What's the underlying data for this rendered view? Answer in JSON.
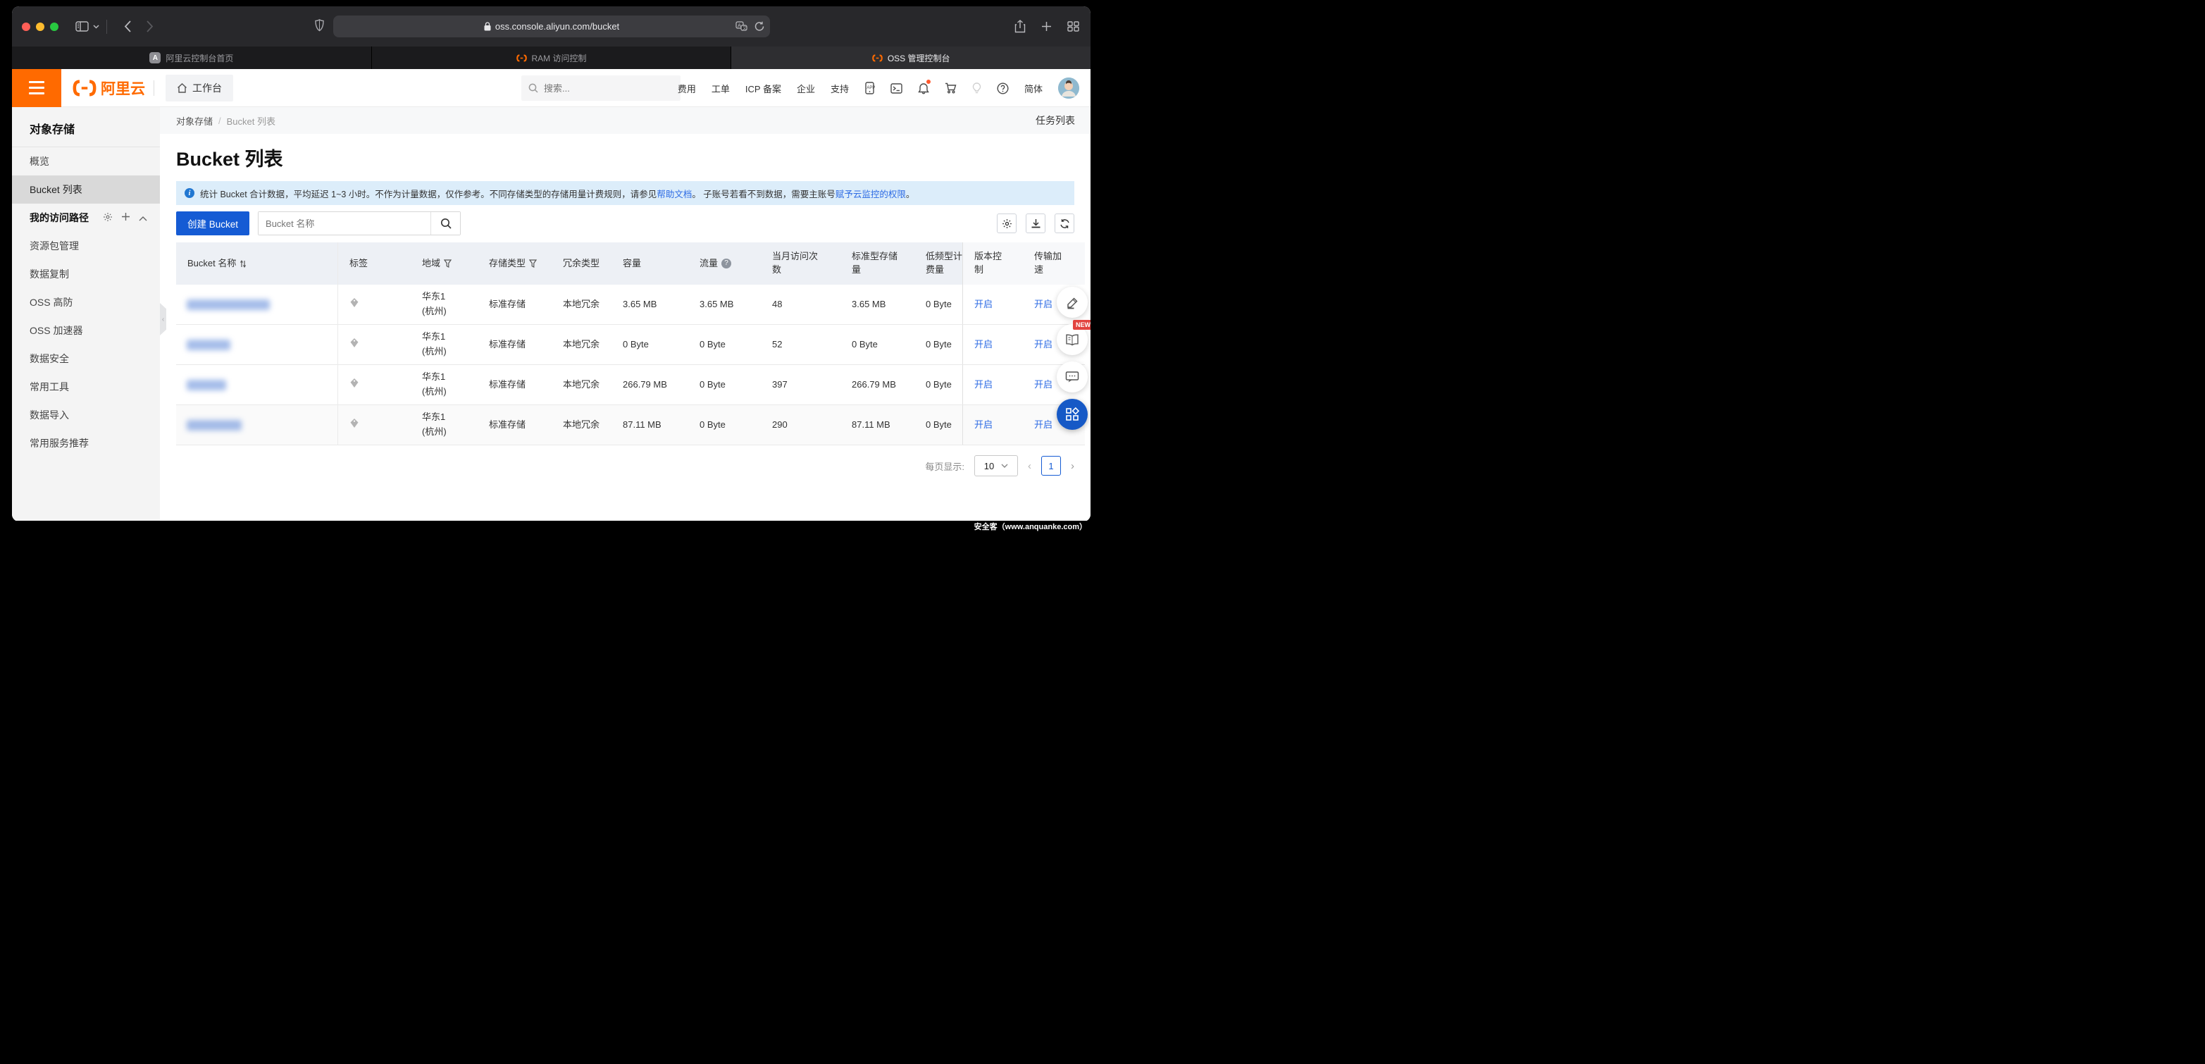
{
  "browser": {
    "url": "oss.console.aliyun.com/bucket",
    "tabs": [
      {
        "label": "阿里云控制台首页",
        "icon_letter": "A"
      },
      {
        "label": "RAM 访问控制"
      },
      {
        "label": "OSS 管理控制台"
      }
    ]
  },
  "header": {
    "brand": "阿里云",
    "workbench": "工作台",
    "search_placeholder": "搜索...",
    "nav": {
      "billing": "费用",
      "tickets": "工单",
      "icp": "ICP 备案",
      "enterprise": "企业",
      "support": "支持"
    },
    "lang": "简体"
  },
  "sidebar": {
    "title": "对象存储",
    "items": {
      "overview": "概览",
      "bucket_list": "Bucket 列表",
      "my_paths": "我的访问路径",
      "resource_pkg": "资源包管理",
      "replication": "数据复制",
      "oss_antiddos": "OSS 高防",
      "oss_accelerator": "OSS 加速器",
      "data_security": "数据安全",
      "common_tools": "常用工具",
      "data_import": "数据导入",
      "recommend": "常用服务推荐"
    }
  },
  "breadcrumb": {
    "root": "对象存储",
    "sep": "/",
    "current": "Bucket 列表",
    "task_list": "任务列表"
  },
  "page": {
    "title": "Bucket 列表"
  },
  "banner": {
    "text_1": "统计 Bucket 合计数据，平均延迟 1~3 小时。不作为计量数据，仅作参考。不同存储类型的存储用量计费规则，请参见",
    "link_help": "帮助文档",
    "text_2": "。 子账号若看不到数据，需要主账号",
    "link_grant": "赋予云监控的权限",
    "text_3": "。"
  },
  "toolbar": {
    "create_button": "创建 Bucket",
    "search_placeholder": "Bucket 名称"
  },
  "table": {
    "columns": [
      "Bucket 名称",
      "标签",
      "地域",
      "存储类型",
      "冗余类型",
      "容量",
      "流量",
      "当月访问次数",
      "标准型存储量",
      "低频型计费量",
      "版本控制",
      "传输加速"
    ],
    "rows": [
      {
        "name_redacted": "",
        "region": "华东1",
        "region_sub": "(杭州)",
        "storage_type": "标准存储",
        "redundancy": "本地冗余",
        "capacity": "3.65 MB",
        "traffic": "3.65 MB",
        "visits": "48",
        "standard_storage": "3.65 MB",
        "ia_billing": "0 Byte",
        "version_control": "开启",
        "transfer_accel": "开启"
      },
      {
        "name_redacted": "",
        "region": "华东1",
        "region_sub": "(杭州)",
        "storage_type": "标准存储",
        "redundancy": "本地冗余",
        "capacity": "0 Byte",
        "traffic": "0 Byte",
        "visits": "52",
        "standard_storage": "0 Byte",
        "ia_billing": "0 Byte",
        "version_control": "开启",
        "transfer_accel": "开启"
      },
      {
        "name_redacted": "",
        "region": "华东1",
        "region_sub": "(杭州)",
        "storage_type": "标准存储",
        "redundancy": "本地冗余",
        "capacity": "266.79 MB",
        "traffic": "0 Byte",
        "visits": "397",
        "standard_storage": "266.79 MB",
        "ia_billing": "0 Byte",
        "version_control": "开启",
        "transfer_accel": "开启"
      },
      {
        "name_redacted": "",
        "region": "华东1",
        "region_sub": "(杭州)",
        "storage_type": "标准存储",
        "redundancy": "本地冗余",
        "capacity": "87.11 MB",
        "traffic": "0 Byte",
        "visits": "290",
        "standard_storage": "87.11 MB",
        "ia_billing": "0 Byte",
        "version_control": "开启",
        "transfer_accel": "开启"
      }
    ]
  },
  "pagination": {
    "per_page_label": "每页显示:",
    "per_page": "10",
    "page": "1"
  },
  "float_widgets": {
    "new_badge": "NEW"
  },
  "watermark": "安全客（www.anquanke.com）",
  "colors": {
    "accent_orange": "#FF6A00",
    "primary_blue": "#155BD4",
    "link_blue": "#2D6BE4",
    "banner_bg": "#DCEDFA",
    "sidebar_bg": "#F4F4F4"
  }
}
